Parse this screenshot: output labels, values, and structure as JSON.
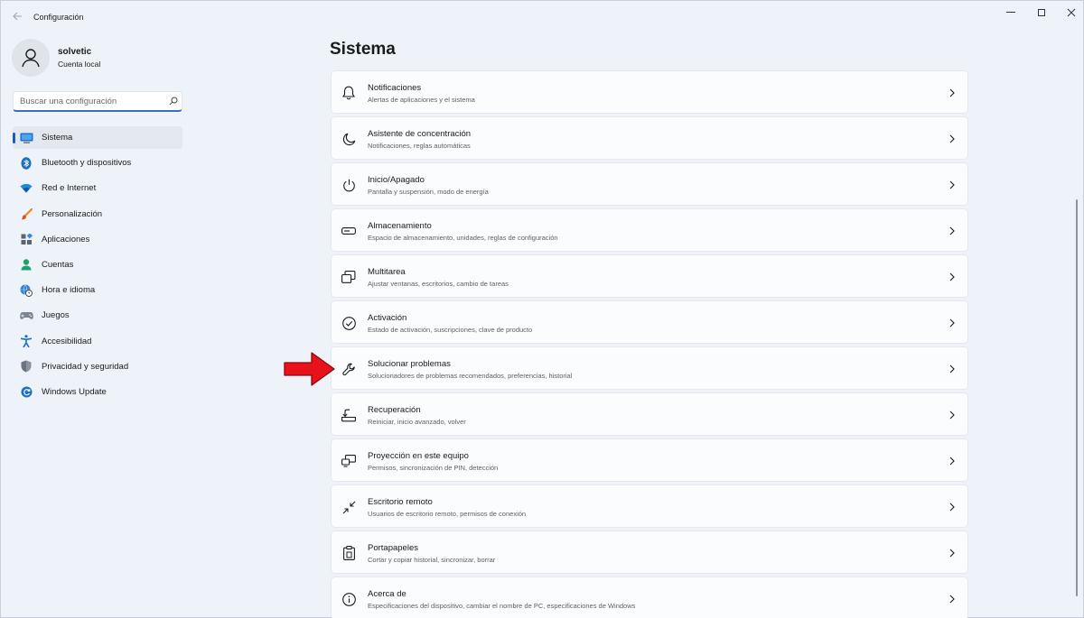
{
  "window": {
    "title": "Configuración"
  },
  "user": {
    "name": "solvetic",
    "account_type": "Cuenta local"
  },
  "search": {
    "placeholder": "Buscar una configuración",
    "value": ""
  },
  "nav": {
    "items": [
      {
        "label": "Sistema",
        "icon": "monitor-icon",
        "active": true
      },
      {
        "label": "Bluetooth y dispositivos",
        "icon": "bluetooth-icon"
      },
      {
        "label": "Red e Internet",
        "icon": "wifi-icon"
      },
      {
        "label": "Personalización",
        "icon": "brush-icon"
      },
      {
        "label": "Aplicaciones",
        "icon": "apps-icon"
      },
      {
        "label": "Cuentas",
        "icon": "person-icon"
      },
      {
        "label": "Hora e idioma",
        "icon": "globe-clock-icon"
      },
      {
        "label": "Juegos",
        "icon": "gamepad-icon"
      },
      {
        "label": "Accesibilidad",
        "icon": "accessibility-icon"
      },
      {
        "label": "Privacidad y seguridad",
        "icon": "shield-icon"
      },
      {
        "label": "Windows Update",
        "icon": "update-icon"
      }
    ]
  },
  "page": {
    "title": "Sistema"
  },
  "settings": [
    {
      "title": "Notificaciones",
      "desc": "Alertas de aplicaciones y el sistema",
      "icon": "bell-icon"
    },
    {
      "title": "Asistente de concentración",
      "desc": "Notificaciones, reglas automáticas",
      "icon": "moon-icon"
    },
    {
      "title": "Inicio/Apagado",
      "desc": "Pantalla y suspensión, modo de energía",
      "icon": "power-icon"
    },
    {
      "title": "Almacenamiento",
      "desc": "Espacio de almacenamiento, unidades, reglas de configuración",
      "icon": "storage-icon"
    },
    {
      "title": "Multitarea",
      "desc": "Ajustar ventanas, escritorios, cambio de tareas",
      "icon": "multitask-icon"
    },
    {
      "title": "Activación",
      "desc": "Estado de activación, suscripciones, clave de producto",
      "icon": "check-circle-icon"
    },
    {
      "title": "Solucionar problemas",
      "desc": "Solucionadores de problemas recomendados, preferencias, historial",
      "icon": "wrench-icon"
    },
    {
      "title": "Recuperación",
      "desc": "Reiniciar, inicio avanzado, volver",
      "icon": "recovery-icon"
    },
    {
      "title": "Proyección en este equipo",
      "desc": "Permisos, sincronización de PIN, detección",
      "icon": "projection-icon"
    },
    {
      "title": "Escritorio remoto",
      "desc": "Usuarios de escritorio remoto, permisos de conexión",
      "icon": "remote-desktop-icon"
    },
    {
      "title": "Portapapeles",
      "desc": "Cortar y copiar historial, sincronizar, borrar",
      "icon": "clipboard-icon"
    },
    {
      "title": "Acerca de",
      "desc": "Especificaciones del dispositivo, cambiar el nombre de PC, especificaciones de Windows",
      "icon": "info-icon"
    }
  ],
  "colors": {
    "accent": "#1a5fb4",
    "annotation_arrow": "#e8121b"
  }
}
